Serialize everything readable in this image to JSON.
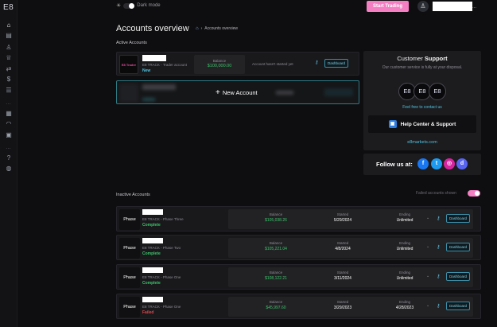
{
  "sidebar": {
    "logo": "E8",
    "icons": [
      "home-icon",
      "document-icon",
      "user-icon",
      "trophy-icon",
      "transfer-icon",
      "dollar-icon",
      "list-icon",
      "calendar-icon",
      "rss-icon",
      "tools-icon",
      "help-icon",
      "globe-icon"
    ]
  },
  "topbar": {
    "dark_mode_label": "Dark mode",
    "start_trading": "Start Trading"
  },
  "header": {
    "title": "Accounts overview",
    "breadcrumb": "Accounts overview"
  },
  "active": {
    "title": "Active Accounts",
    "card": {
      "thumb": "E8 Trader",
      "subtitle": "E8 TRACK - Trader account",
      "status": "New",
      "balance_label": "Balance",
      "balance_value": "$100,000.00",
      "note": "Account hasn't started yet",
      "dashboard": "Dashboard"
    },
    "new_account": "New Account"
  },
  "support": {
    "title_a": "Customer",
    "title_b": "Support",
    "desc": "Our customer service is fully at your disposal.",
    "avatars": [
      "E8",
      "E8",
      "E8"
    ],
    "contact": "Feel free to contact us",
    "help_button": "Help Center & Support",
    "site": "e8markets.com"
  },
  "follow": {
    "label": "Follow us at:",
    "networks": [
      "facebook-icon",
      "twitter-icon",
      "instagram-icon",
      "discord-icon"
    ]
  },
  "inactive": {
    "title": "Inactive Accounts",
    "failed_shown": "Failed accounts shown",
    "labels": {
      "balance": "Balance",
      "started": "Started",
      "ending": "Ending",
      "dashboard": "Dashboard"
    },
    "accounts": [
      {
        "thumb": "Phase",
        "subtitle": "E8 TRACK - Phase Three",
        "status": "Complete",
        "balance": "$105,038.26",
        "started": "5/29/2024",
        "ending": "Unlimited"
      },
      {
        "thumb": "Phase",
        "subtitle": "E8 TRACK - Phase Two",
        "status": "Complete",
        "balance": "$105,221.04",
        "started": "4/8/2024",
        "ending": "Unlimited"
      },
      {
        "thumb": "Phase",
        "subtitle": "E8 TRACK - Phase One",
        "status": "Complete",
        "balance": "$108,122.21",
        "started": "3/11/2024",
        "ending": "Unlimited"
      },
      {
        "thumb": "Phase",
        "subtitle": "E8 TRACK - Phase One",
        "status": "Failed",
        "balance": "$45,997.60",
        "started": "3/29/2023",
        "ending": "4/28/2023"
      }
    ]
  },
  "colors": {
    "accent_pink": "#f47fc3",
    "success": "#3cc46a",
    "danger": "#e0474c",
    "link": "#4fc3e0"
  }
}
